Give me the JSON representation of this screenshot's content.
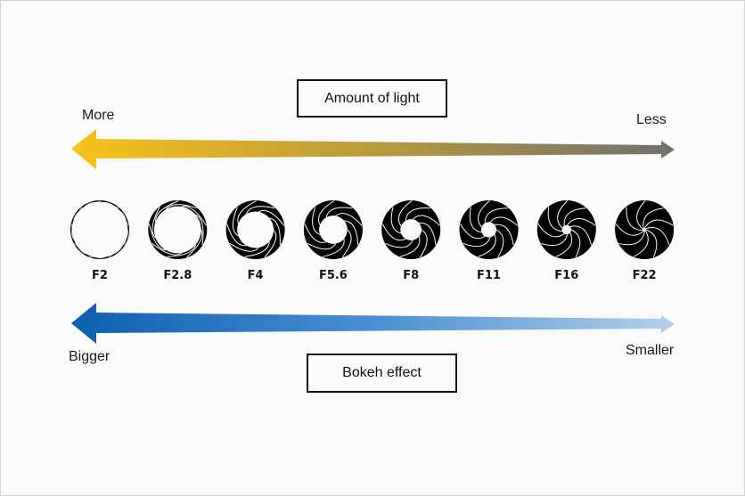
{
  "diagram": {
    "light": {
      "title": "Amount of light",
      "left_label": "More",
      "right_label": "Less",
      "colors": {
        "start": "#f8c21c",
        "mid": "#b99a3c",
        "end": "#707070"
      }
    },
    "bokeh": {
      "title": "Bokeh effect",
      "left_label": "Bigger",
      "right_label": "Smaller",
      "colors": {
        "start": "#0d5fb0",
        "mid": "#4a8fd0",
        "end": "#b4cfeb"
      }
    },
    "apertures": [
      {
        "label": "F2",
        "opening": 0.95
      },
      {
        "label": "F2.8",
        "opening": 0.8
      },
      {
        "label": "F4",
        "opening": 0.62
      },
      {
        "label": "F5.6",
        "opening": 0.48
      },
      {
        "label": "F8",
        "opening": 0.36
      },
      {
        "label": "F11",
        "opening": 0.26
      },
      {
        "label": "F16",
        "opening": 0.16
      },
      {
        "label": "F22",
        "opening": 0.06
      }
    ]
  }
}
